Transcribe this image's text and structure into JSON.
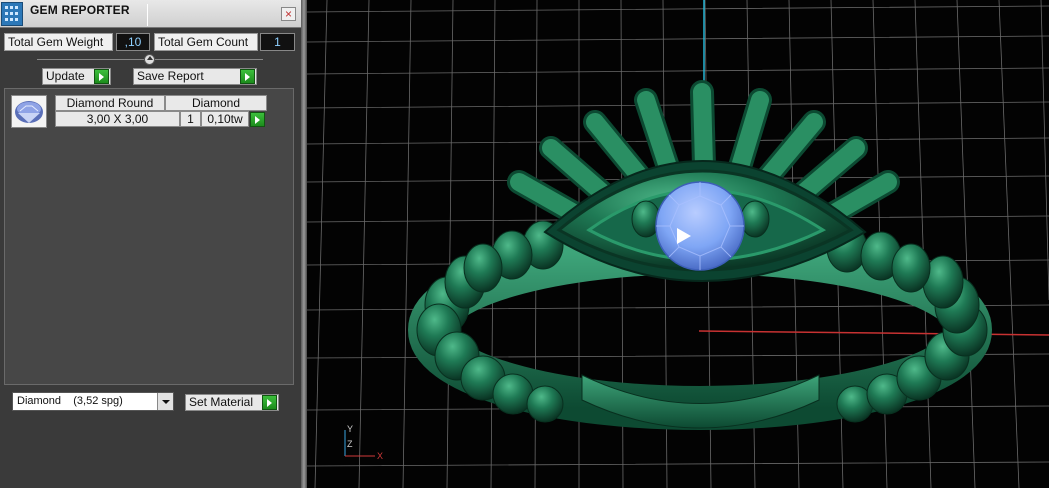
{
  "panel": {
    "title": "GEM REPORTER",
    "close_label": "×",
    "total_weight_label": "Total Gem Weight",
    "total_weight_value": ",10",
    "total_count_label": "Total Gem Count",
    "total_count_value": "1",
    "update_label": "Update",
    "save_report_label": "Save Report"
  },
  "gem_table": {
    "headers": [
      "Diamond Round",
      "Diamond"
    ],
    "row": {
      "size": "3,00 X 3,00",
      "count": "1",
      "weight": "0,10tw"
    }
  },
  "material": {
    "selected": "Diamond    (3,52 spg)",
    "set_label": "Set Material"
  },
  "viewport": {
    "axis_labels": {
      "y": "Y",
      "z": "Z",
      "x": "X"
    },
    "metal_color": "#1f7a55",
    "gem_color": "#7fa6f5",
    "grid_color": "#6a6a6a",
    "background": "#030303"
  }
}
